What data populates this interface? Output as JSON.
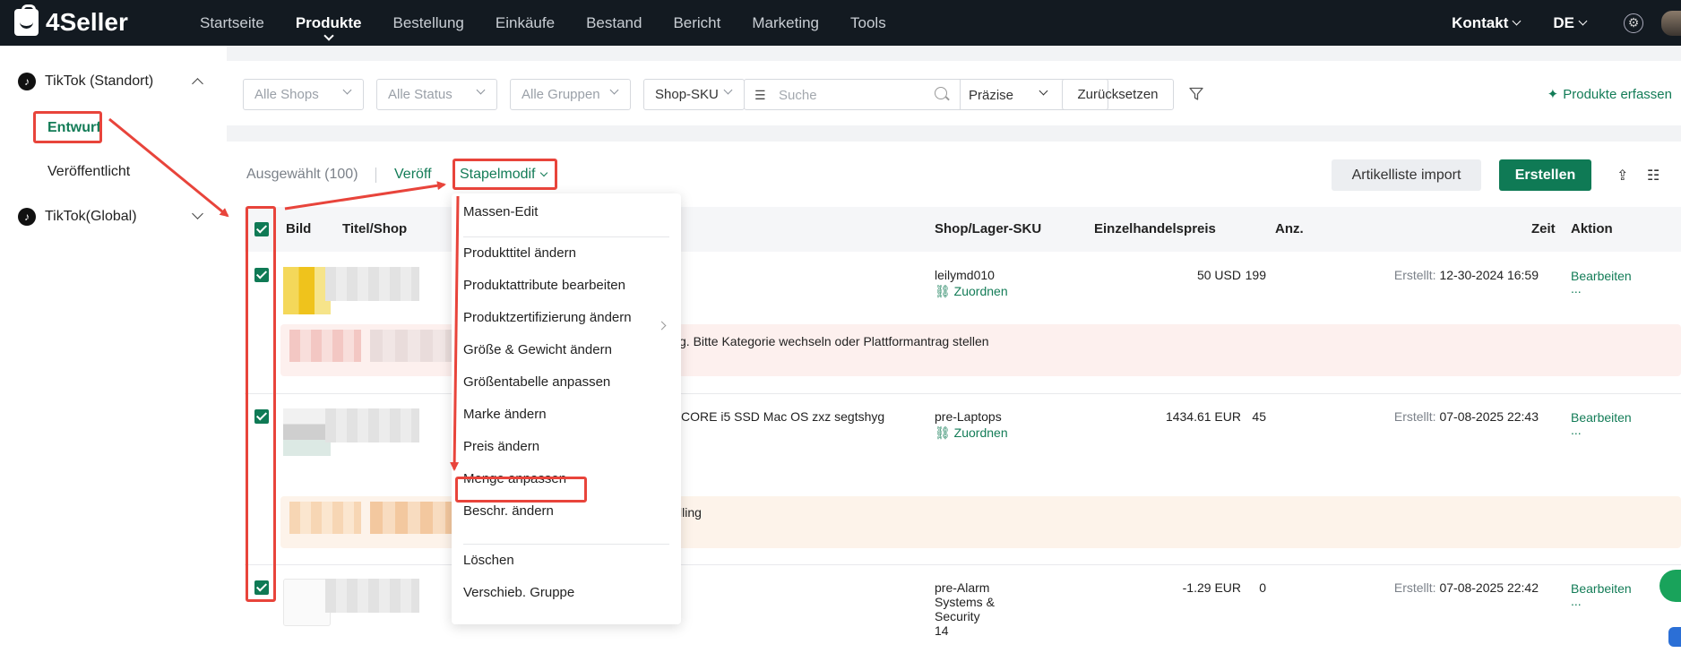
{
  "app": {
    "name": "4Seller"
  },
  "nav": {
    "items": [
      "Startseite",
      "Produkte",
      "Bestellung",
      "Einkäufe",
      "Bestand",
      "Bericht",
      "Marketing",
      "Tools"
    ],
    "active": "Produkte"
  },
  "topright": {
    "contact": "Kontakt",
    "lang": "DE"
  },
  "sidebar": {
    "groups": [
      {
        "label": "TikTok (Standort)",
        "expanded": true,
        "items": [
          "Entwurf",
          "Veröffentlicht"
        ],
        "active_item": "Entwurf"
      },
      {
        "label": "TikTok(Global)",
        "expanded": false
      }
    ]
  },
  "filters": {
    "shops": "Alle Shops",
    "status": "Alle Status",
    "groups": "Alle Gruppen",
    "sku_type": "Shop-SKU",
    "search_placeholder": "Suche",
    "precision": "Präzise",
    "reset": "Zurücksetzen",
    "capture": "Produkte erfassen"
  },
  "toolbar": {
    "selected": "Ausgewählt (100)",
    "publish": "Veröff",
    "batch_edit": "Stapelmodif",
    "import": "Artikelliste import",
    "create": "Erstellen"
  },
  "table": {
    "headers": {
      "image": "Bild",
      "title": "Titel/Shop",
      "sku": "Shop/Lager-SKU",
      "price": "Einzelhandelspreis",
      "qty": "Anz.",
      "time": "Zeit",
      "action": "Aktion"
    },
    "rows": [
      {
        "sku": "leilymd010",
        "map": "Zuordnen",
        "price": "50 USD",
        "qty": "199",
        "created_label": "Erstellt:",
        "created": "12-30-2024 16:59",
        "edit": "Bearbeiten",
        "more": "...",
        "title_fragment": "",
        "warning": "g. Bitte Kategorie wechseln oder Plattformantrag stellen",
        "warn_color": "#fdf0ee"
      },
      {
        "sku": "pre-Laptops",
        "map": "Zuordnen",
        "price": "1434.61 EUR",
        "qty": "45",
        "created_label": "Erstellt:",
        "created": "07-08-2025 22:43",
        "edit": "Bearbeiten",
        "more": "...",
        "title_fragment": "CORE i5 SSD Mac OS zxz segtshyg",
        "warning": "lling",
        "warn_color": "#fdf3ea"
      },
      {
        "sku_lines": [
          "pre-Alarm",
          "Systems &",
          "Security",
          "14"
        ],
        "price": "-1.29 EUR",
        "qty": "0",
        "created_label": "Erstellt:",
        "created": "07-08-2025 22:42",
        "edit": "Bearbeiten",
        "more": "..."
      }
    ]
  },
  "batch_menu": {
    "items": [
      {
        "label": "Massen-Edit"
      },
      {
        "label": "Produkttitel ändern"
      },
      {
        "label": "Produktattribute bearbeiten"
      },
      {
        "label": "Produktzertifizierung ändern",
        "submenu": true
      },
      {
        "label": "Größe & Gewicht ändern"
      },
      {
        "label": "Größentabelle anpassen"
      },
      {
        "label": "Marke ändern"
      },
      {
        "label": "Preis ändern"
      },
      {
        "label": "Menge anpassen",
        "highlighted": true
      },
      {
        "label": "Beschr. ändern"
      },
      {
        "label": "Löschen"
      },
      {
        "label": "Verschieb. Gruppe"
      }
    ]
  },
  "colors": {
    "brand_green": "#0f7a55",
    "annotation_red": "#e8443b",
    "topbar": "#131a21"
  },
  "icons": [
    "tiktok-icon",
    "chevron-down-icon",
    "chevron-up-icon",
    "gear-icon",
    "search-icon",
    "filter-icon",
    "sparkle-icon",
    "link-icon",
    "export-icon",
    "column-settings-icon",
    "checkbox-icon"
  ]
}
